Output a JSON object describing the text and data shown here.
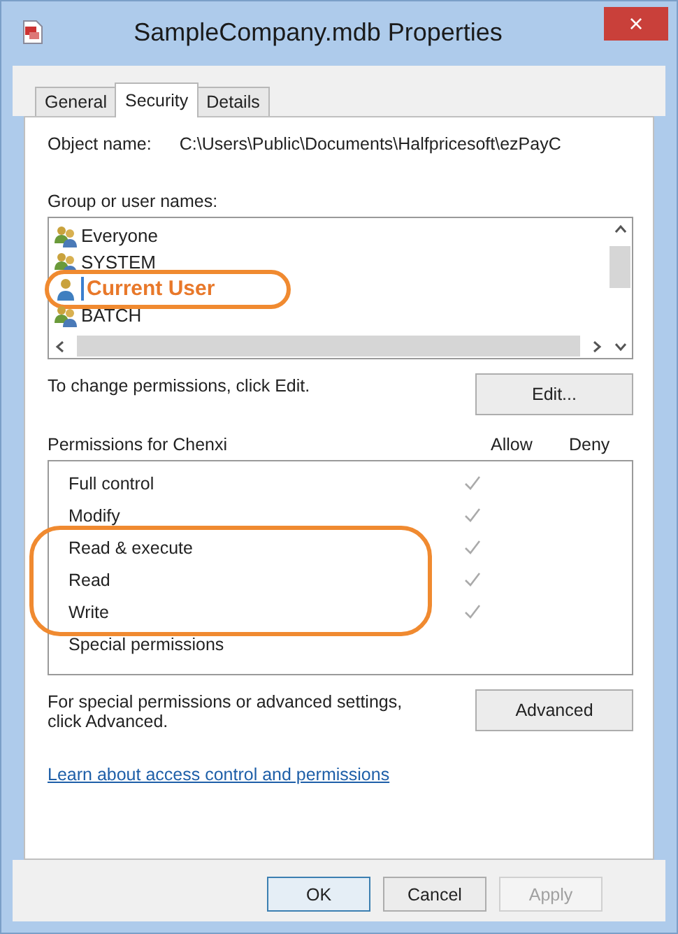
{
  "window": {
    "title": "SampleCompany.mdb Properties",
    "close": "×"
  },
  "tabs": [
    {
      "label": "General",
      "selected": false
    },
    {
      "label": "Security",
      "selected": true
    },
    {
      "label": "Details",
      "selected": false
    }
  ],
  "object_name": {
    "label": "Object name:",
    "value": "C:\\Users\\Public\\Documents\\Halfpricesoft\\ezPayC"
  },
  "users": {
    "label": "Group or user names:",
    "items": [
      {
        "name": "Everyone",
        "kind": "group",
        "highlighted": false
      },
      {
        "name": "SYSTEM",
        "kind": "group",
        "highlighted": false
      },
      {
        "name": "Current User",
        "kind": "user",
        "highlighted": true
      },
      {
        "name": "BATCH",
        "kind": "group",
        "highlighted": false
      }
    ]
  },
  "edit_hint": "To change permissions, click Edit.",
  "edit_button": "Edit...",
  "permissions": {
    "label": "Permissions for Chenxi",
    "columns": [
      "Allow",
      "Deny"
    ],
    "rows": [
      {
        "name": "Full control",
        "allow": true,
        "deny": false,
        "highlighted": false
      },
      {
        "name": "Modify",
        "allow": true,
        "deny": false,
        "highlighted": false
      },
      {
        "name": "Read & execute",
        "allow": true,
        "deny": false,
        "highlighted": true
      },
      {
        "name": "Read",
        "allow": true,
        "deny": false,
        "highlighted": true
      },
      {
        "name": "Write",
        "allow": true,
        "deny": false,
        "highlighted": true
      },
      {
        "name": "Special permissions",
        "allow": false,
        "deny": false,
        "highlighted": false
      }
    ]
  },
  "advanced_hint": "For special permissions or advanced settings, click Advanced.",
  "advanced_button": "Advanced",
  "link": "Learn about access control and permissions",
  "buttons": [
    {
      "label": "OK",
      "disabled": false,
      "default": true
    },
    {
      "label": "Cancel",
      "disabled": false,
      "default": false
    },
    {
      "label": "Apply",
      "disabled": true,
      "default": false
    }
  ]
}
